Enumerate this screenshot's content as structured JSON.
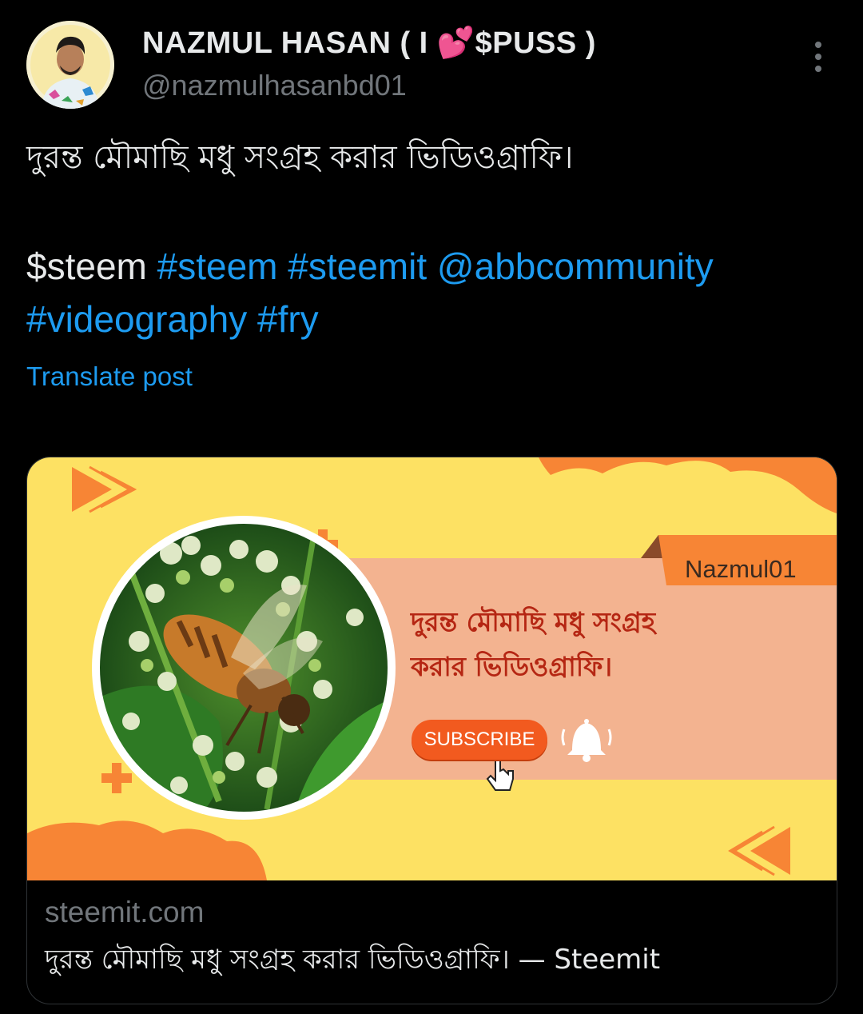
{
  "author": {
    "display_name": "NAZMUL HASAN ( I",
    "display_name_emoji": "💕",
    "display_name_suffix": "$PUSS )",
    "handle": "@nazmulhasanbd01"
  },
  "post": {
    "text": "দুরন্ত মৌমাছি মধু সংগ্রহ করার ভিডিওগ্রাফি।",
    "cashtag": "$steem",
    "tags": [
      "#steem",
      "#steemit",
      "@abbcommunity",
      "#videography",
      "#fry"
    ],
    "translate_label": "Translate post"
  },
  "card": {
    "thumbnail": {
      "brand": "Nazmul01",
      "headline_line1": "দুরন্ত মৌমাছি মধু সংগ্রহ",
      "headline_line2": "করার ভিডিওগ্রাফি।",
      "subscribe_label": "SUBSCRIBE"
    },
    "domain": "steemit.com",
    "title": "দুরন্ত মৌমাছি মধু সংগ্রহ করার ভিডিওগ্রাফি। — Steemit"
  },
  "colors": {
    "background": "#000000",
    "text": "#e7e9ea",
    "secondary": "#71767b",
    "link": "#1d9bf0",
    "thumb_yellow": "#fde163",
    "thumb_orange": "#f78535",
    "thumb_peach": "#f3b390"
  },
  "icons": {
    "more": "more-vertical-icon",
    "bell": "bell-icon",
    "pointer": "hand-pointer-icon"
  }
}
